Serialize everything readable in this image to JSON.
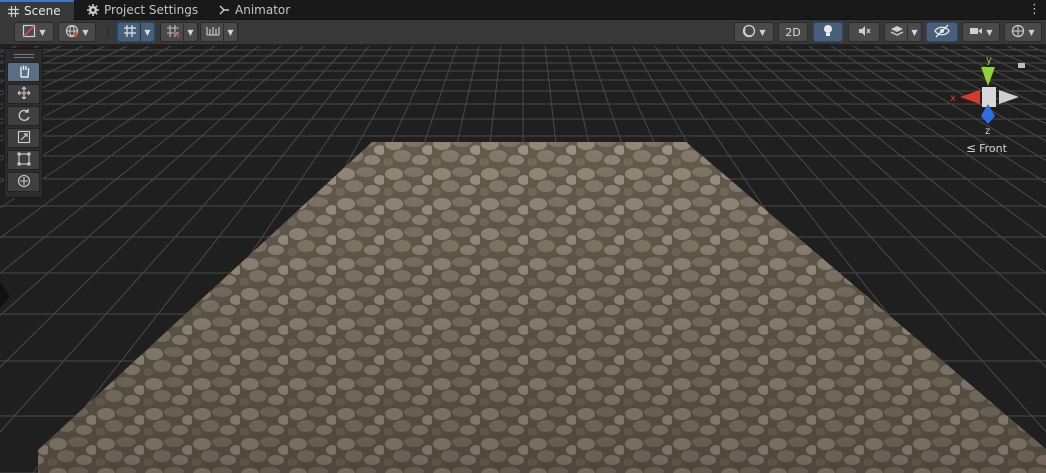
{
  "tabs": [
    {
      "label": "Scene",
      "icon": "grid-icon",
      "active": true
    },
    {
      "label": "Project Settings",
      "icon": "gear-icon",
      "active": false
    },
    {
      "label": "Animator",
      "icon": "animator-icon",
      "active": false
    }
  ],
  "toolbar": {
    "draw_mode_icon": "draw-mode-icon",
    "global_icon": "globe-icon",
    "grid_snap_icon": "grid-snap-icon",
    "increment_snap_icon": "increment-snap-icon",
    "ruler_icon": "ruler-icon",
    "shading_icon": "shading-sphere-icon",
    "mode_2d_label": "2D",
    "lighting_icon": "lightbulb-icon",
    "audio_icon": "audio-mute-icon",
    "effects_icon": "effects-layers-icon",
    "visibility_icon": "hidden-eye-icon",
    "camera_icon": "camera-icon",
    "gizmos_icon": "gizmo-globe-icon"
  },
  "tool_palette": [
    {
      "name": "hand-tool",
      "icon": "hand-icon",
      "active": true
    },
    {
      "name": "move-tool",
      "icon": "move-icon",
      "active": false
    },
    {
      "name": "rotate-tool",
      "icon": "rotate-icon",
      "active": false
    },
    {
      "name": "scale-tool",
      "icon": "scale-icon",
      "active": false
    },
    {
      "name": "rect-tool",
      "icon": "rect-icon",
      "active": false
    },
    {
      "name": "transform-tool",
      "icon": "transform-icon",
      "active": false
    }
  ],
  "gizmo": {
    "y_label": "y",
    "x_label": "x",
    "z_label": "z",
    "view_label": "Front",
    "colors": {
      "x": "#d63b2a",
      "y": "#8ed234",
      "z": "#2e6fe0"
    }
  },
  "scene": {
    "background": "#1f1f1f",
    "grid_color": "#4a4a4a",
    "plane_texture": "cobblestone"
  }
}
